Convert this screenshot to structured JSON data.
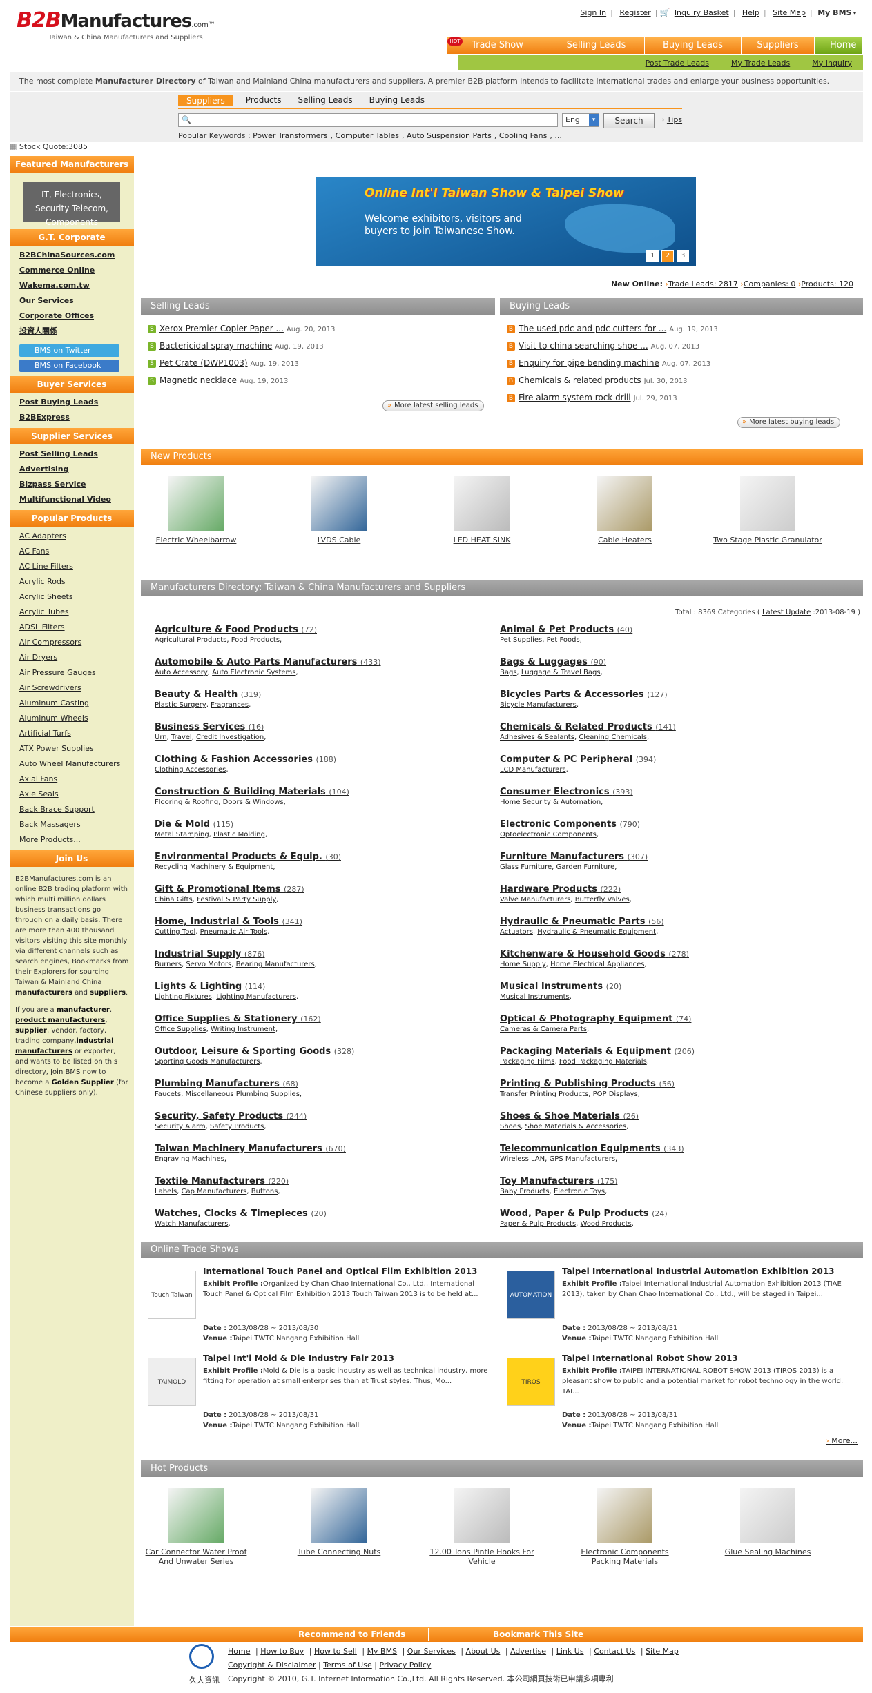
{
  "header": {
    "logo_b2b": "B2B",
    "logo_mf": "Manufactures",
    "logo_suffix": ".com™",
    "tagline": "Taiwan & China Manufacturers and Suppliers",
    "top_links": [
      "Sign In",
      "Register",
      "Inquiry Basket",
      "Help",
      "Site Map"
    ],
    "my_bms": "My BMS",
    "nav": [
      "Trade Show",
      "Selling Leads",
      "Buying Leads",
      "Suppliers",
      "Home"
    ],
    "hot_badge": "HOT",
    "subnav": [
      "Post Trade Leads",
      "My Trade Leads",
      "My Inquiry"
    ]
  },
  "intro": {
    "pre": "The most complete ",
    "bold": "Manufacturer Directory",
    "post": " of Taiwan and Mainland China manufacturers and suppliers. A premier B2B platform intends to facilitate international trades and enlarge your business opportunities."
  },
  "search": {
    "tabs": [
      "Suppliers",
      "Products",
      "Selling Leads",
      "Buying Leads"
    ],
    "lang": "Eng",
    "button": "Search",
    "tips": "Tips",
    "popular_label": "Popular Keywords : ",
    "popular": [
      "Power Transformers",
      "Computer Tables",
      "Auto Suspension Parts",
      "Cooling Fans"
    ],
    "ellipsis": "..."
  },
  "stock": {
    "label": "Stock Quote:",
    "code": "3085"
  },
  "sidebar": {
    "featured": "Featured Manufacturers",
    "featured_box": "IT, Electronics, Security Telecom, Components",
    "gt_head": "G.T. Corporate",
    "gt_links": [
      "B2BChinaSources.com",
      "Commerce Online",
      "Wakema.com.tw",
      "Our Services",
      "Corporate Offices",
      "投資人關係"
    ],
    "twitter": "BMS on Twitter",
    "facebook": "BMS on Facebook",
    "buyer_head": "Buyer Services",
    "buyer_links": [
      "Post Buying Leads",
      "B2BExpress"
    ],
    "supplier_head": "Supplier Services",
    "supplier_links": [
      "Post Selling Leads",
      "Advertising",
      "Bizpass Service",
      "Multifunctional Video"
    ],
    "popular_head": "Popular Products",
    "popular": [
      "AC Adapters",
      "AC Fans",
      "AC Line Filters",
      "Acrylic Rods",
      "Acrylic Sheets",
      "Acrylic Tubes",
      "ADSL Filters",
      "Air Compressors",
      "Air Dryers",
      "Air Pressure Gauges",
      "Air Screwdrivers",
      "Aluminum Casting",
      "Aluminum Wheels",
      "Artificial Turfs",
      "ATX Power Supplies",
      "Auto Wheel Manufacturers",
      "Axial Fans",
      "Axle Seals",
      "Back Brace Support",
      "Back Massagers",
      "More Products..."
    ],
    "join_head": "Join Us",
    "join_p1": "B2BManufactures.com is an online B2B trading platform with which multi million dollars business transactions go through on a daily basis. There are more than 400 thousand visitors visiting this site monthly via different channels such as search engines, Bookmarks from their Explorers for sourcing Taiwan & Mainland China ",
    "join_b1": "manufacturers",
    "join_and": " and ",
    "join_b2": "suppliers",
    "join_dot": ".",
    "join_p2a": "If you are a ",
    "join_m": "manufacturer",
    "join_pm": "product manufacturers",
    "join_s": "supplier",
    "join_p2b": ", vendor, factory, trading company,",
    "join_im": "industrial manufacturers",
    "join_p2c": " or exporter, and wants to be listed on this directory, ",
    "join_link": "Join BMS",
    "join_p2d": " now to become a ",
    "join_gs": "Golden Supplier",
    "join_p2e": " (for Chinese suppliers only)."
  },
  "banner": {
    "title": "Online Int'l Taiwan Show & Taipei Show",
    "text": "Welcome exhibitors, visitors and buyers to join Taiwanese Show.",
    "pages": [
      "1",
      "2",
      "3"
    ],
    "active": "2"
  },
  "new_online": {
    "label": "New Online:",
    "trade": "Trade Leads: 2817",
    "companies": "Companies: 0",
    "products": "Products: 120"
  },
  "selling": {
    "head": "Selling Leads",
    "more": "More latest selling leads",
    "items": [
      {
        "t": "Xerox Premier Copier Paper ...",
        "d": "Aug. 20, 2013"
      },
      {
        "t": "Bactericidal spray machine",
        "d": "Aug. 19, 2013"
      },
      {
        "t": "Pet Crate (DWP1003)",
        "d": "Aug. 19, 2013"
      },
      {
        "t": "Magnetic necklace",
        "d": "Aug. 19, 2013"
      }
    ]
  },
  "buying": {
    "head": "Buying Leads",
    "more": "More latest buying leads",
    "items": [
      {
        "t": "The used pdc and pdc cutters for ...",
        "d": "Aug. 19, 2013"
      },
      {
        "t": "Visit to china searching shoe ...",
        "d": "Aug. 07, 2013"
      },
      {
        "t": "Enquiry for pipe bending machine",
        "d": "Aug. 07, 2013"
      },
      {
        "t": "Chemicals & related products",
        "d": "Jul. 30, 2013"
      },
      {
        "t": "Fire alarm system rock drill",
        "d": "Jul. 29, 2013"
      }
    ]
  },
  "new_products": {
    "head": "New Products",
    "items": [
      "Electric Wheelbarrow",
      "LVDS Cable",
      "LED HEAT SINK",
      "Cable Heaters",
      "Two Stage Plastic Granulator"
    ]
  },
  "directory": {
    "head": "Manufacturers Directory: Taiwan & China Manufacturers and Suppliers",
    "total": "Total : 8369 Categories (  ",
    "latest": "Latest Update",
    "date": " :2013-08-19 )",
    "left": [
      {
        "n": "Agriculture & Food Products",
        "c": "(72)",
        "s": [
          "Agricultural Products",
          "Food Products"
        ]
      },
      {
        "n": "Automobile & Auto Parts Manufacturers",
        "c": "(433)",
        "s": [
          "Auto Accessory",
          "Auto Electronic Systems"
        ]
      },
      {
        "n": "Beauty & Health",
        "c": "(319)",
        "s": [
          "Plastic Surgery",
          "Fragrances"
        ]
      },
      {
        "n": "Business Services",
        "c": "(16)",
        "s": [
          "Urn",
          "Travel",
          "Credit Investigation"
        ]
      },
      {
        "n": "Clothing & Fashion Accessories",
        "c": "(188)",
        "s": [
          "Clothing Accessories"
        ]
      },
      {
        "n": "Construction & Building Materials",
        "c": "(104)",
        "s": [
          "Flooring & Roofing",
          "Doors & Windows"
        ]
      },
      {
        "n": "Die & Mold",
        "c": "(115)",
        "s": [
          "Metal Stamping",
          "Plastic Molding"
        ]
      },
      {
        "n": "Environmental Products & Equip.",
        "c": "(30)",
        "s": [
          "Recycling Machinery & Equipment"
        ]
      },
      {
        "n": "Gift & Promotional Items",
        "c": "(287)",
        "s": [
          "China Gifts",
          "Festival & Party Supply"
        ]
      },
      {
        "n": "Home, Industrial & Tools",
        "c": "(341)",
        "s": [
          "Cutting Tool",
          "Pneumatic Air Tools"
        ]
      },
      {
        "n": "Industrial Supply",
        "c": "(876)",
        "s": [
          "Burners",
          "Servo Motors",
          "Bearing Manufacturers"
        ]
      },
      {
        "n": "Lights & Lighting",
        "c": "(114)",
        "s": [
          "Lighting Fixtures",
          "Lighting Manufacturers"
        ]
      },
      {
        "n": "Office Supplies & Stationery",
        "c": "(162)",
        "s": [
          "Office Supplies",
          "Writing Instrument"
        ]
      },
      {
        "n": "Outdoor, Leisure & Sporting Goods",
        "c": "(328)",
        "s": [
          "Sporting Goods Manufacturers"
        ]
      },
      {
        "n": "Plumbing Manufacturers",
        "c": "(68)",
        "s": [
          "Faucets",
          "Miscellaneous Plumbing Supplies"
        ]
      },
      {
        "n": "Security, Safety Products",
        "c": "(244)",
        "s": [
          "Security Alarm",
          "Safety Products"
        ]
      },
      {
        "n": "Taiwan Machinery Manufacturers",
        "c": "(670)",
        "s": [
          "Engraving Machines"
        ]
      },
      {
        "n": "Textile Manufacturers",
        "c": "(220)",
        "s": [
          "Labels",
          "Cap Manufacturers",
          "Buttons"
        ]
      },
      {
        "n": "Watches, Clocks & Timepieces",
        "c": "(20)",
        "s": [
          "Watch Manufacturers"
        ]
      }
    ],
    "right": [
      {
        "n": "Animal & Pet Products",
        "c": "(40)",
        "s": [
          "Pet Supplies",
          "Pet Foods"
        ]
      },
      {
        "n": "Bags & Luggages",
        "c": "(90)",
        "s": [
          "Bags",
          "Luggage & Travel Bags"
        ]
      },
      {
        "n": "Bicycles Parts & Accessories",
        "c": "(127)",
        "s": [
          "Bicycle Manufacturers"
        ]
      },
      {
        "n": "Chemicals & Related Products",
        "c": "(141)",
        "s": [
          "Adhesives & Sealants",
          "Cleaning Chemicals"
        ]
      },
      {
        "n": "Computer & PC Peripheral",
        "c": "(394)",
        "s": [
          "LCD Manufacturers"
        ]
      },
      {
        "n": "Consumer Electronics",
        "c": "(393)",
        "s": [
          "Home Security & Automation"
        ]
      },
      {
        "n": "Electronic Components",
        "c": "(790)",
        "s": [
          "Optoelectronic Components"
        ]
      },
      {
        "n": "Furniture Manufacturers",
        "c": "(307)",
        "s": [
          "Glass Furniture",
          "Garden Furniture"
        ]
      },
      {
        "n": "Hardware Products",
        "c": "(222)",
        "s": [
          "Valve Manufacturers",
          "Butterfly Valves"
        ]
      },
      {
        "n": "Hydraulic & Pneumatic Parts",
        "c": "(56)",
        "s": [
          "Actuators",
          "Hydraulic & Pneumatic Equipment"
        ]
      },
      {
        "n": "Kitchenware & Household Goods",
        "c": "(278)",
        "s": [
          "Home Supply",
          "Home Electrical Appliances"
        ]
      },
      {
        "n": "Musical Instruments",
        "c": "(20)",
        "s": [
          "Musical Instruments"
        ]
      },
      {
        "n": "Optical & Photography Equipment",
        "c": "(74)",
        "s": [
          "Cameras & Camera Parts"
        ]
      },
      {
        "n": "Packaging Materials & Equipment",
        "c": "(206)",
        "s": [
          "Packaging Films",
          "Food Packaging Materials"
        ]
      },
      {
        "n": "Printing & Publishing Products",
        "c": "(56)",
        "s": [
          "Transfer Printing Products",
          "POP Displays"
        ]
      },
      {
        "n": "Shoes & Shoe Materials",
        "c": "(26)",
        "s": [
          "Shoes",
          "Shoe Materials & Accessories"
        ]
      },
      {
        "n": "Telecommunication Equipments",
        "c": "(343)",
        "s": [
          "Wireless LAN",
          "GPS Manufacturers"
        ]
      },
      {
        "n": "Toy Manufacturers",
        "c": "(175)",
        "s": [
          "Baby Products",
          "Electronic Toys"
        ]
      },
      {
        "n": "Wood, Paper & Pulp Products",
        "c": "(24)",
        "s": [
          "Paper & Pulp Products",
          "Wood Products"
        ]
      }
    ]
  },
  "shows": {
    "head": "Online Trade Shows",
    "more": "More...",
    "label_profile": "Exhibit Profile :",
    "label_date": "Date :",
    "label_venue": "Venue :",
    "items": [
      {
        "t": "International Touch Panel and Optical Film Exhibition 2013",
        "p": "Organized by Chan Chao International Co., Ltd., International Touch Panel & Optical Film Exhibition 2013 Touch Taiwan 2013 is to be held at...",
        "d": "2013/08/28 ~ 2013/08/30",
        "v": "Taipei TWTC Nangang Exhibition Hall",
        "logo": "Touch Taiwan"
      },
      {
        "t": "Taipei International Industrial Automation Exhibition 2013",
        "p": "Taipei International Industrial Automation Exhibition 2013 (TIAE 2013), taken by Chan Chao International Co., Ltd., will be staged in Taipei...",
        "d": "2013/08/28 ~ 2013/08/31",
        "v": "Taipei TWTC Nangang Exhibition Hall",
        "logo": "AUTOMATION"
      },
      {
        "t": "Taipei Int'l Mold & Die Industry Fair 2013",
        "p": "Mold & Die is a basic industry as well as technical industry, more fitting for operation at small enterprises than at Trust styles. Thus, Mo...",
        "d": "2013/08/28 ~ 2013/08/31",
        "v": "Taipei TWTC Nangang Exhibition Hall",
        "logo": "TAIMOLD"
      },
      {
        "t": "Taipei International Robot Show 2013",
        "p": "TAIPEI INTERNATIONAL ROBOT SHOW 2013 (TIROS 2013) is a pleasant show to public and a potential market for robot technology in the world. TAI...",
        "d": "2013/08/28 ~ 2013/08/31",
        "v": "Taipei TWTC Nangang Exhibition Hall",
        "logo": "TIROS"
      }
    ]
  },
  "hot": {
    "head": "Hot Products",
    "items": [
      "Car Connector Water Proof And Unwater Series",
      "Tube Connecting Nuts",
      "12.00 Tons Pintle Hooks For Vehicle",
      "Electronic Components Packing Materials",
      "Glue Sealing Machines"
    ]
  },
  "footer": {
    "recommend": "Recommend to Friends",
    "bookmark": "Bookmark This Site",
    "links": [
      "Home",
      "How to Buy",
      "How to Sell",
      "My BMS",
      "Our Services",
      "About Us",
      "Advertise",
      "Link Us",
      "Contact Us",
      "Site Map"
    ],
    "links2": [
      "Copyright & Disclaimer",
      "Terms of Use",
      "Privacy Policy"
    ],
    "company_cn": "久大資訊",
    "copy": "Copyright © 2010, G.T. Internet Information Co.,Ltd. All Rights Reserved. 本公司網頁技術已申請多項專利"
  }
}
